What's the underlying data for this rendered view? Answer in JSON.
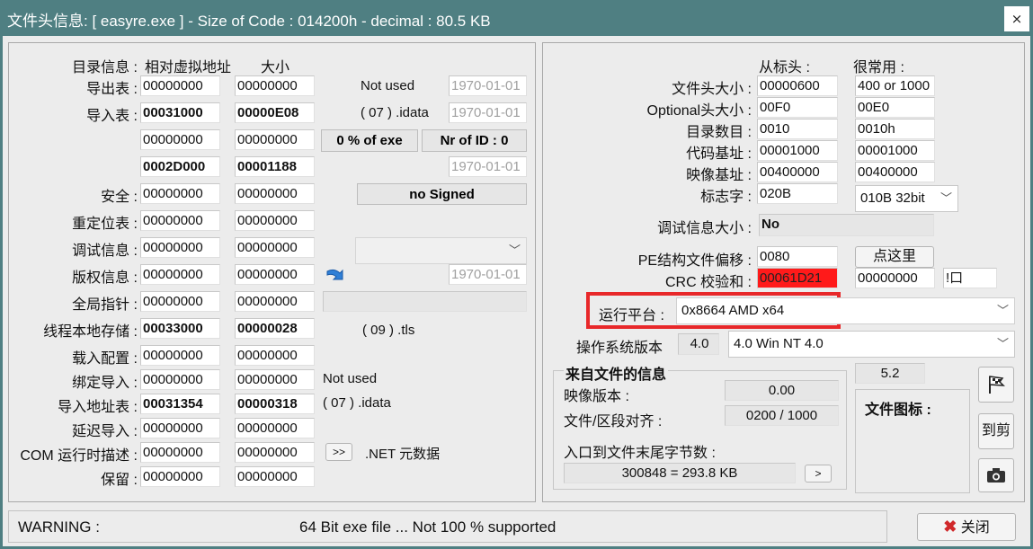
{
  "window": {
    "title": "文件头信息: [ easyre.exe ] - Size of Code : 014200h - decimal : 80.5 KB",
    "close_glyph": "×"
  },
  "left": {
    "header": {
      "label": "目录信息 :",
      "rva": "相对虚拟地址",
      "size": "大小"
    },
    "rows": [
      {
        "label": "导出表 :",
        "rva": "00000000",
        "size": "00000000",
        "bold": false
      },
      {
        "label": "导入表 :",
        "rva": "00031000",
        "size": "00000E08",
        "bold": true
      },
      {
        "label": "",
        "rva": "00000000",
        "size": "00000000",
        "bold": false
      },
      {
        "label": "",
        "rva": "0002D000",
        "size": "00001188",
        "bold": true
      },
      {
        "label": "安全 :",
        "rva": "00000000",
        "size": "00000000",
        "bold": false
      },
      {
        "label": "重定位表 :",
        "rva": "00000000",
        "size": "00000000",
        "bold": false
      },
      {
        "label": "调试信息 :",
        "rva": "00000000",
        "size": "00000000",
        "bold": false
      },
      {
        "label": "版权信息 :",
        "rva": "00000000",
        "size": "00000000",
        "bold": false
      },
      {
        "label": "全局指针 :",
        "rva": "00000000",
        "size": "00000000",
        "bold": false
      },
      {
        "label": "线程本地存储 :",
        "rva": "00033000",
        "size": "00000028",
        "bold": true
      },
      {
        "label": "载入配置 :",
        "rva": "00000000",
        "size": "00000000",
        "bold": false
      },
      {
        "label": "绑定导入 :",
        "rva": "00000000",
        "size": "00000000",
        "bold": false
      },
      {
        "label": "导入地址表 :",
        "rva": "00031354",
        "size": "00000318",
        "bold": true
      },
      {
        "label": "延迟导入 :",
        "rva": "00000000",
        "size": "00000000",
        "bold": false
      },
      {
        "label": "COM 运行时描述 :",
        "rva": "00000000",
        "size": "00000000",
        "bold": false
      },
      {
        "label": "保留 :",
        "rva": "00000000",
        "size": "00000000",
        "bold": false
      }
    ],
    "extra": {
      "export_note": "Not used",
      "export_date": "1970-01-01",
      "import_note": "( 07 ) .idata",
      "import_date": "1970-01-01",
      "pct_exe": "0  % of exe",
      "nr_of_id": "Nr of ID : 0",
      "res_date": "1970-01-01",
      "signed": "no Signed",
      "copyright_date": "1970-01-01",
      "tls_note": "( 09 ) .tls",
      "bound_note": "Not used",
      "iat_note": "( 07 ) .idata",
      "com_btn": ">>",
      "com_note": ".NET 元数据"
    }
  },
  "right": {
    "col_from": "从标头 :",
    "col_common": "很常用 :",
    "rows": [
      {
        "label": "文件头大小 :",
        "from": "00000600",
        "common": "400 or 1000"
      },
      {
        "label": "Optional头大小 :",
        "from": "00F0",
        "common": "00E0"
      },
      {
        "label": "目录数目 :",
        "from": "0010",
        "common": "0010h"
      },
      {
        "label": "代码基址 :",
        "from": "00001000",
        "common": "00001000"
      },
      {
        "label": "映像基址 :",
        "from": "00400000",
        "common": "00400000"
      }
    ],
    "flags_label": "标志字 :",
    "flags_value": "020B",
    "flags_combo": "010B 32bit",
    "debug_label": "调试信息大小 :",
    "debug_value": "No",
    "pe_label": "PE结构文件偏移 :",
    "pe_value": "0080",
    "pe_btn": "点这里",
    "crc_label": "CRC 校验和 :",
    "crc_value": "00061D21",
    "crc_value2": "00000000",
    "crc_flag": "!口",
    "platform_label": "运行平台 :",
    "platform_value": "0x8664  AMD x64",
    "os_label": "操作系统版本",
    "os_value": "4.0",
    "os_combo": "4.0  Win NT 4.0",
    "fileinfo_title": "来自文件的信息",
    "image_ver_label": "映像版本 :",
    "image_ver": "0.00",
    "align_label": "文件/区段对齐 :",
    "align_value": "0200  /  1000",
    "eof_label": "入口到文件末尾字节数 :",
    "eof_value": "300848  =  293.8 KB",
    "eof_btn": ">",
    "linker": "5.2",
    "icon_label": "文件图标 :",
    "side_btn2": "到剪"
  },
  "status": {
    "label": "WARNING :",
    "message": "64 Bit exe file ... Not 100 % supported",
    "close_btn": "关闭"
  },
  "colors": {
    "title_bg": "#4f7f82",
    "highlight": "#e8282a",
    "crc_red": "#ff1a1a"
  }
}
